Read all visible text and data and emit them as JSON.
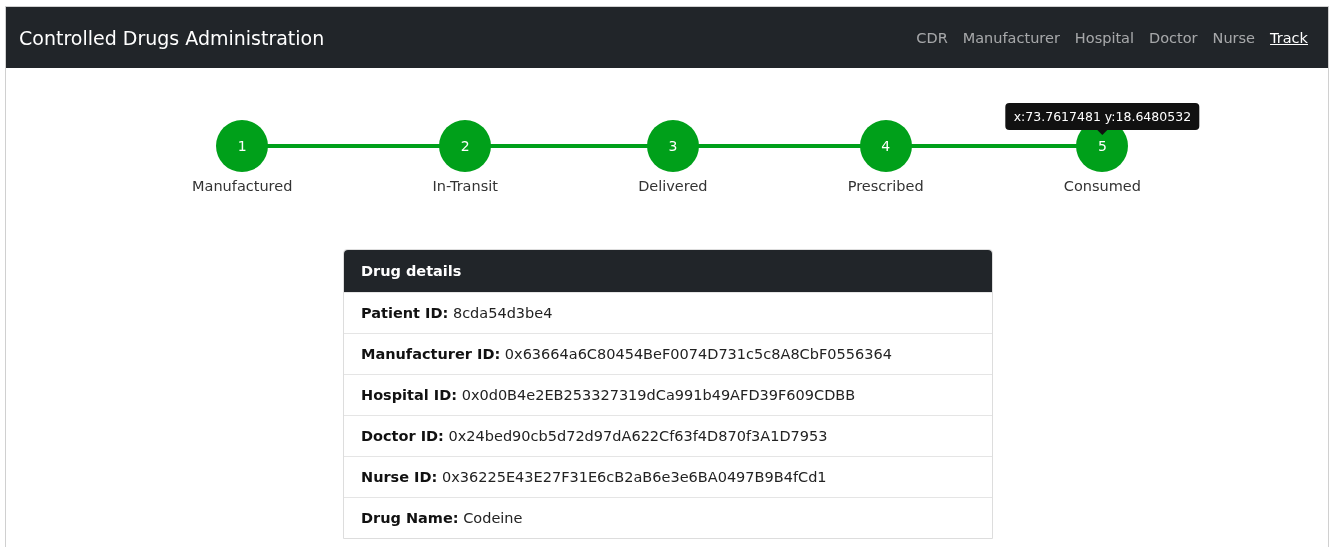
{
  "navbar": {
    "brand": "Controlled Drugs Administration",
    "links": [
      {
        "label": "CDR",
        "selected": false
      },
      {
        "label": "Manufacturer",
        "selected": false
      },
      {
        "label": "Hospital",
        "selected": false
      },
      {
        "label": "Doctor",
        "selected": false
      },
      {
        "label": "Nurse",
        "selected": false
      },
      {
        "label": "Track",
        "selected": true
      }
    ]
  },
  "progress": {
    "steps": [
      {
        "number": "1",
        "label": "Manufactured",
        "completed": true
      },
      {
        "number": "2",
        "label": "In-Transit",
        "completed": true
      },
      {
        "number": "3",
        "label": "Delivered",
        "completed": true
      },
      {
        "number": "4",
        "label": "Prescribed",
        "completed": true
      },
      {
        "number": "5",
        "label": "Consumed",
        "completed": true,
        "tooltip": "x:73.7617481 y:18.6480532"
      }
    ]
  },
  "drug_details": {
    "title": "Drug details",
    "rows": [
      {
        "label": "Patient ID:",
        "value": "8cda54d3be4"
      },
      {
        "label": "Manufacturer ID:",
        "value": "0x63664a6C80454BeF0074D731c5c8A8CbF0556364"
      },
      {
        "label": "Hospital ID:",
        "value": "0x0d0B4e2EB253327319dCa991b49AFD39F609CDBB"
      },
      {
        "label": "Doctor ID:",
        "value": "0x24bed90cb5d72d97dA622Cf63f4D870f3A1D7953"
      },
      {
        "label": "Nurse ID:",
        "value": "0x36225E43E27F31E6cB2aB6e3e6BA0497B9B4fCd1"
      },
      {
        "label": "Drug Name:",
        "value": "Codeine"
      }
    ]
  }
}
